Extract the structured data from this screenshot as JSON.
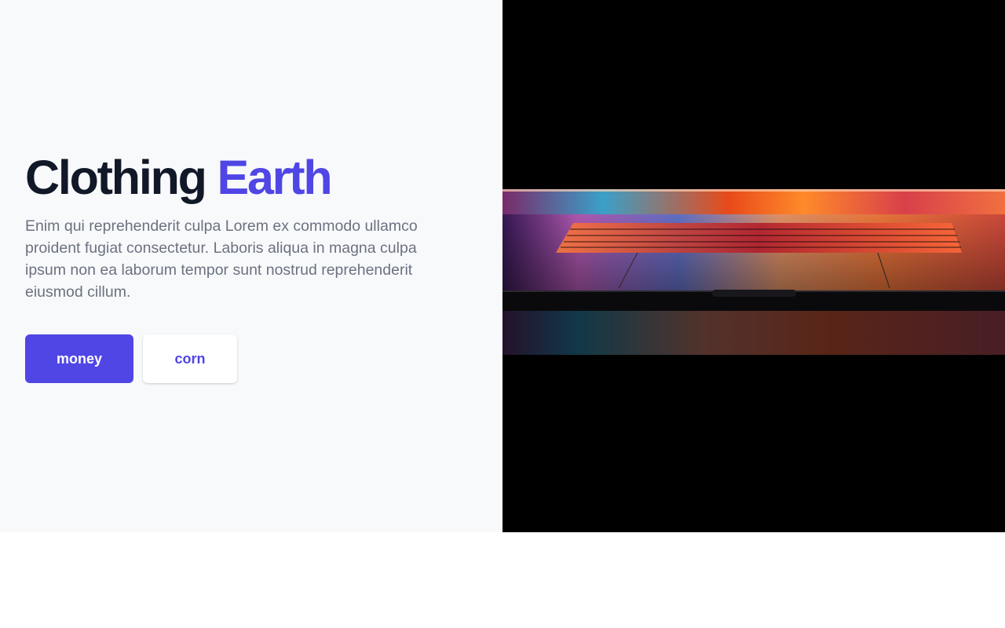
{
  "hero": {
    "title_main": "Clothing",
    "title_accent": "Earth",
    "description": "Enim qui reprehenderit culpa Lorem ex commodo ullamco proident fugiat consectetur. Laboris aliqua in magna culpa ipsum non ea laborum tempor sunt nostrud reprehenderit eiusmod cillum.",
    "primary_button": "money",
    "secondary_button": "corn"
  },
  "image": {
    "subject": "laptop-photo"
  },
  "colors": {
    "accent": "#4f46e5",
    "heading": "#111827",
    "body_text": "#6b7280",
    "panel_bg": "#f8f9fb"
  }
}
